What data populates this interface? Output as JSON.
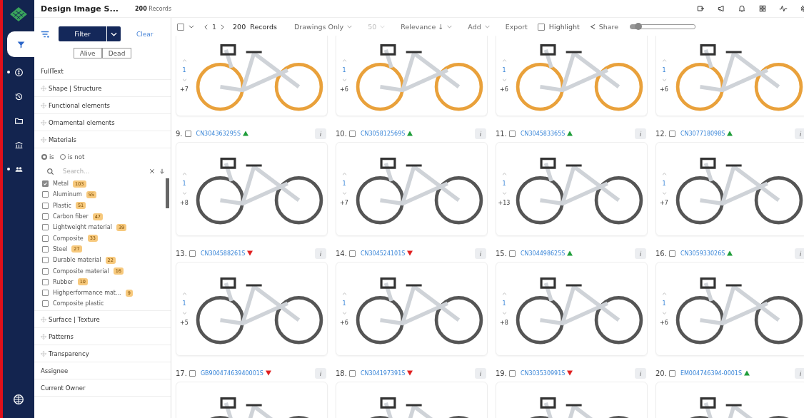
{
  "rail": {
    "items": [
      {
        "selected": true,
        "dot": false
      },
      {
        "selected": false,
        "dot": true
      },
      {
        "selected": false,
        "dot": false
      },
      {
        "selected": false,
        "dot": false
      },
      {
        "selected": false,
        "dot": false
      },
      {
        "selected": false,
        "dot": true
      }
    ]
  },
  "header": {
    "title": "Design Image S...",
    "count": "200",
    "count_label": "Records"
  },
  "filter_panel": {
    "filter_button": "Filter",
    "clear": "Clear",
    "status": [
      {
        "label": "Alive",
        "selected": false
      },
      {
        "label": "Dead",
        "selected": false
      }
    ],
    "sections": [
      {
        "label": "FullText",
        "kind": "field"
      },
      {
        "label": "Shape | Structure",
        "kind": "group"
      },
      {
        "label": "Functional elements",
        "kind": "group"
      },
      {
        "label": "Ornamental elements",
        "kind": "group"
      },
      {
        "label": "Materials",
        "kind": "group"
      }
    ],
    "materials": {
      "modes": [
        {
          "label": "is",
          "selected": true
        },
        {
          "label": "is not",
          "selected": false
        }
      ],
      "search_placeholder": "Search...",
      "options": [
        {
          "label": "Metal",
          "count": "103",
          "checked": true
        },
        {
          "label": "Aluminum",
          "count": "55",
          "checked": false
        },
        {
          "label": "Plastic",
          "count": "51",
          "checked": false
        },
        {
          "label": "Carbon fiber",
          "count": "47",
          "checked": false
        },
        {
          "label": "Lightweight material",
          "count": "39",
          "checked": false
        },
        {
          "label": "Composite",
          "count": "33",
          "checked": false
        },
        {
          "label": "Steel",
          "count": "27",
          "checked": false
        },
        {
          "label": "Durable material",
          "count": "22",
          "checked": false
        },
        {
          "label": "Composite material",
          "count": "16",
          "checked": false
        },
        {
          "label": "Rubber",
          "count": "10",
          "checked": false
        },
        {
          "label": "Highperformance mat...",
          "count": "9",
          "checked": false
        },
        {
          "label": "Composite plastic",
          "checked": false
        }
      ]
    },
    "more_sections": [
      {
        "label": "Surface | Texture",
        "kind": "group"
      },
      {
        "label": "Patterns",
        "kind": "group"
      },
      {
        "label": "Transparency",
        "kind": "group"
      },
      {
        "label": "Assignee",
        "kind": "field"
      },
      {
        "label": "Current Owner",
        "kind": "field"
      }
    ]
  },
  "toolbar": {
    "select_all": {
      "checked": false
    },
    "page": "1",
    "records_count": "200",
    "records_label": "Records",
    "view": "Drawings Only",
    "page_size": "50",
    "sort": "Relevance ↓",
    "add": "Add",
    "export": "Export",
    "highlight": {
      "label": "Highlight",
      "checked": false
    },
    "share": "Share",
    "zoom": {
      "level": 0.12
    }
  },
  "top_cards": [
    {
      "votes": "1",
      "more": "+7"
    },
    {
      "votes": "1",
      "more": "+6"
    },
    {
      "votes": "1",
      "more": "+6"
    },
    {
      "votes": "1",
      "more": "+6"
    }
  ],
  "cards": [
    {
      "index": "9.",
      "number": "CN304363295S",
      "kind": "up",
      "checked": false,
      "votes": "1",
      "more": "+8"
    },
    {
      "index": "10.",
      "number": "CN305812569S",
      "kind": "up",
      "checked": false,
      "votes": "1",
      "more": "+7"
    },
    {
      "index": "11.",
      "number": "CN304583365S",
      "kind": "up",
      "checked": false,
      "votes": "1",
      "more": "+13"
    },
    {
      "index": "12.",
      "number": "CN307718098S",
      "kind": "up",
      "checked": false,
      "votes": "1",
      "more": "+7"
    },
    {
      "index": "13.",
      "number": "CN304588261S",
      "kind": "down",
      "checked": false,
      "votes": "1",
      "more": "+5"
    },
    {
      "index": "14.",
      "number": "CN304524101S",
      "kind": "down",
      "checked": false,
      "votes": "1",
      "more": "+6"
    },
    {
      "index": "15.",
      "number": "CN304498625S",
      "kind": "up",
      "checked": false,
      "votes": "1",
      "more": "+8"
    },
    {
      "index": "16.",
      "number": "CN305933026S",
      "kind": "up",
      "checked": false,
      "votes": "1",
      "more": "+6"
    },
    {
      "index": "17.",
      "number": "GB90047463940001S",
      "kind": "down",
      "checked": false
    },
    {
      "index": "18.",
      "number": "CN304197391S",
      "kind": "down",
      "checked": false
    },
    {
      "index": "19.",
      "number": "CN303530991S",
      "kind": "down",
      "checked": false
    },
    {
      "index": "20.",
      "number": "EM004746394-0001S",
      "kind": "up",
      "checked": false
    }
  ]
}
